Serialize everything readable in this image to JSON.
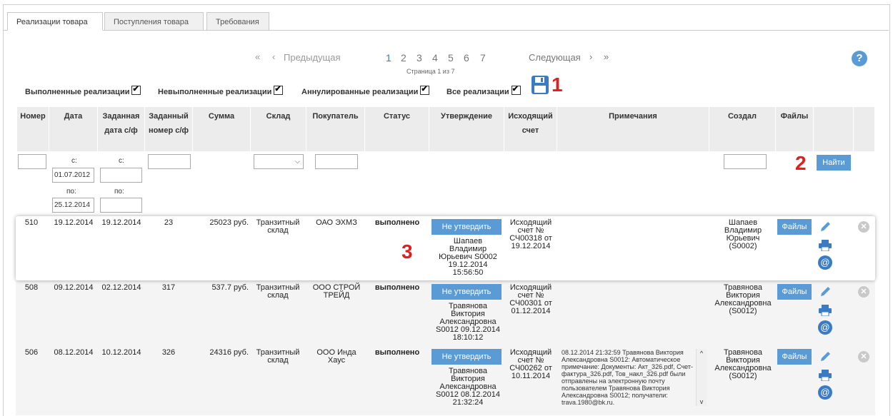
{
  "tabs": [
    "Реализации товара",
    "Поступления товара",
    "Требования"
  ],
  "pager": {
    "prev": "Предыдущая",
    "next": "Следующая",
    "pages": [
      "1",
      "2",
      "3",
      "4",
      "5",
      "6",
      "7"
    ],
    "info": "Страница 1 из 7",
    "first_icon": "«",
    "prev_icon": "‹",
    "next_icon": "›",
    "last_icon": "»"
  },
  "help": "?",
  "filters": {
    "done": "Выполненные реализации",
    "undone": "Невыполненные реализации",
    "cancelled": "Аннулированные реализации",
    "all": "Все реализации"
  },
  "markers": [
    "1",
    "2",
    "3"
  ],
  "columns": [
    "Номер",
    "Дата",
    "Заданная дата с/ф",
    "Заданный номер с/ф",
    "Сумма",
    "Склад",
    "Покупатель",
    "Статус",
    "Утверждение",
    "Исходящий счет",
    "Примечания",
    "Создал",
    "Файлы"
  ],
  "filter_row": {
    "from": "с:",
    "to": "по:",
    "date_from": "01.07.2012",
    "date_to": "25.12.2014",
    "find": "Найти"
  },
  "approve_btn": "Не утвердить",
  "files_btn": "Файлы",
  "rows": [
    {
      "num": "510",
      "date": "19.12.2014",
      "sf_date": "19.12.2014",
      "sf_num": "23",
      "sum": "25023 руб.",
      "warehouse": [
        "Транзитный",
        "склад"
      ],
      "buyer": [
        "ОАО ЭХМЗ"
      ],
      "status": "выполнено",
      "approval": [
        "Шапаев",
        "Владимир",
        "Юрьевич S0002",
        "19.12.2014",
        "15:56:50"
      ],
      "invoice": [
        "Исходящий",
        "счет №",
        "СЧ00318 от",
        "19.12.2014"
      ],
      "note": "",
      "creator": [
        "Шапаев",
        "Владимир",
        "Юрьевич",
        "(S0002)"
      ]
    },
    {
      "num": "508",
      "date": "09.12.2014",
      "sf_date": "02.12.2014",
      "sf_num": "317",
      "sum": "537.7 руб.",
      "warehouse": [
        "Транзитный",
        "склад"
      ],
      "buyer": [
        "ООО СТРОЙ",
        "ТРЕЙД"
      ],
      "status": "выполнено",
      "approval": [
        "Травянова",
        "Виктория",
        "Александровна",
        "S0012 09.12.2014",
        "18:10:12"
      ],
      "invoice": [
        "Исходящий",
        "счет №",
        "СЧ00301 от",
        "01.12.2014"
      ],
      "note": "",
      "creator": [
        "Травянова",
        "Виктория",
        "Александровна",
        "(S0012)"
      ]
    },
    {
      "num": "506",
      "date": "08.12.2014",
      "sf_date": "10.12.2014",
      "sf_num": "326",
      "sum": "24316 руб.",
      "warehouse": [
        "Транзитный",
        "склад"
      ],
      "buyer": [
        "ООО Инда",
        "Хаус"
      ],
      "status": "выполнено",
      "approval": [
        "Травянова",
        "Виктория",
        "Александровна",
        "S0012 08.12.2014",
        "21:32:24"
      ],
      "invoice": [
        "Исходящий",
        "счет №",
        "СЧ00262 от",
        "10.11.2014"
      ],
      "note": "08.12.2014 21:32:59 Травянова Виктория Александровна S0012: Автоматическое примечание: Документы: Акт_326.pdf, Счет-фактура_326.pdf, Тов_накл_326.pdf были отправлены на электронную почту пользователем Травянова Виктория Александровна S0012; получатели: trava.1980@bk.ru.",
      "creator": [
        "Травянова",
        "Виктория",
        "Александровна",
        "(S0012)"
      ]
    }
  ],
  "colors": {
    "accent": "#5b9bd5",
    "link": "#3b7bc4",
    "marker": "#e0201e",
    "header_bg": "#ececec"
  },
  "icons": [
    "save-icon",
    "edit-icon",
    "print-icon",
    "email-icon",
    "delete-icon",
    "help-icon"
  ]
}
